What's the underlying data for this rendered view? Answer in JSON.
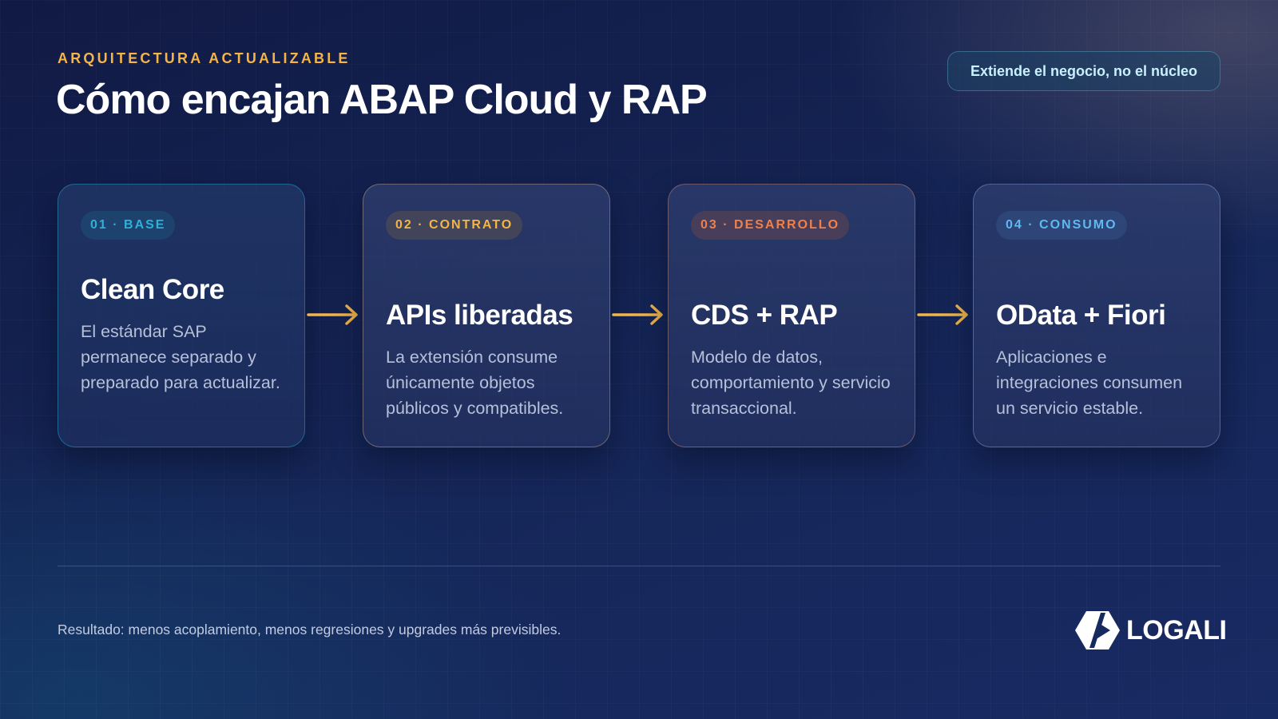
{
  "header": {
    "eyebrow": "ARQUITECTURA ACTUALIZABLE",
    "title": "Cómo encajan ABAP Cloud y RAP",
    "tag": "Extiende el negocio, no el núcleo"
  },
  "steps": [
    {
      "badge": "01 · BASE",
      "title": "Clean Core",
      "description": "El estándar SAP permanece separado y preparado para actualizar.",
      "accent": "#2fb0d8"
    },
    {
      "badge": "02 · CONTRATO",
      "title": "APIs liberadas",
      "description": "La extensión consume únicamente objetos públicos y compatibles.",
      "accent": "#f3b54a"
    },
    {
      "badge": "03 · DESARROLLO",
      "title": "CDS + RAP",
      "description": "Modelo de datos, comportamiento y servicio transaccional.",
      "accent": "#f0804a"
    },
    {
      "badge": "04 · CONSUMO",
      "title": "OData + Fiori",
      "description": "Aplicaciones e integraciones consumen un servicio estable.",
      "accent": "#5fb8f0"
    }
  ],
  "arrow_color": "#f3b54a",
  "footer": {
    "note": "Resultado: menos acoplamiento, menos regresiones y upgrades más previsibles.",
    "logo_text": "LOGALI"
  }
}
